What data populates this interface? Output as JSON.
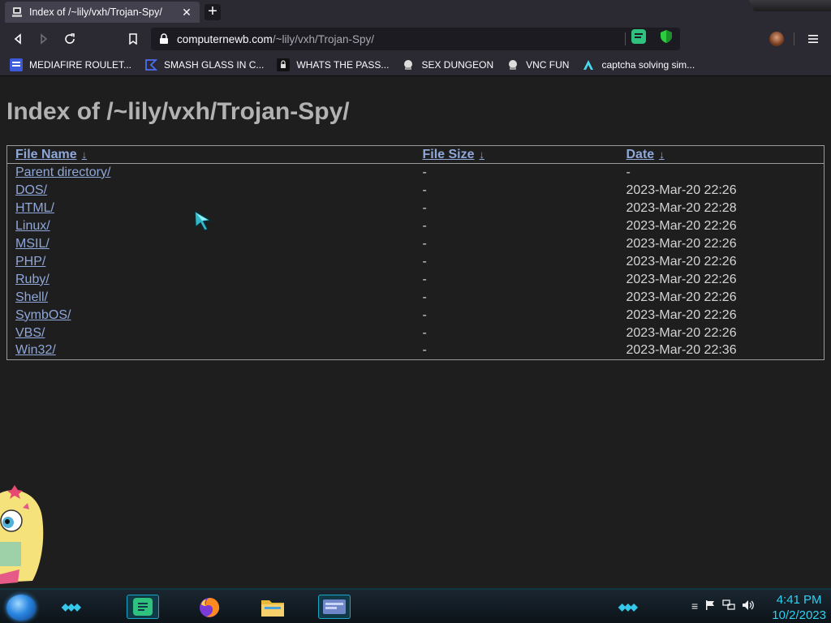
{
  "browser": {
    "tab": {
      "title": "Index of /~lily/vxh/Trojan-Spy/",
      "close_label": "✕"
    },
    "new_tab_label": "+",
    "url": {
      "host": "computernewb.com",
      "path": "/~lily/vxh/Trojan-Spy/"
    },
    "bookmarks": [
      {
        "label": "MEDIAFIRE ROULET...",
        "icon": "mediafire-icon"
      },
      {
        "label": "SMASH GLASS IN C...",
        "icon": "smash-glass-icon"
      },
      {
        "label": "WHATS THE PASS...",
        "icon": "password-site-icon"
      },
      {
        "label": "SEX DUNGEON",
        "icon": "dungeon-icon"
      },
      {
        "label": "VNC FUN",
        "icon": "vnc-icon"
      },
      {
        "label": "captcha solving sim...",
        "icon": "captcha-icon"
      }
    ]
  },
  "page": {
    "title": "Index of /~lily/vxh/Trojan-Spy/",
    "columns": {
      "name": "File Name",
      "size": "File Size",
      "date": "Date",
      "sort_arrow": "↓"
    },
    "rows": [
      {
        "name": "Parent directory/",
        "size": "-",
        "date": "-"
      },
      {
        "name": "DOS/",
        "size": "-",
        "date": "2023-Mar-20 22:26"
      },
      {
        "name": "HTML/",
        "size": "-",
        "date": "2023-Mar-20 22:28"
      },
      {
        "name": "Linux/",
        "size": "-",
        "date": "2023-Mar-20 22:26"
      },
      {
        "name": "MSIL/",
        "size": "-",
        "date": "2023-Mar-20 22:26"
      },
      {
        "name": "PHP/",
        "size": "-",
        "date": "2023-Mar-20 22:26"
      },
      {
        "name": "Ruby/",
        "size": "-",
        "date": "2023-Mar-20 22:26"
      },
      {
        "name": "Shell/",
        "size": "-",
        "date": "2023-Mar-20 22:26"
      },
      {
        "name": "SymbOS/",
        "size": "-",
        "date": "2023-Mar-20 22:26"
      },
      {
        "name": "VBS/",
        "size": "-",
        "date": "2023-Mar-20 22:26"
      },
      {
        "name": "Win32/",
        "size": "-",
        "date": "2023-Mar-20 22:36"
      }
    ]
  },
  "taskbar": {
    "apps": [
      "notes-app-icon",
      "firefox-icon",
      "file-explorer-icon",
      "window-manager-icon"
    ],
    "clock": {
      "time": "4:41 PM",
      "date": "10/2/2023"
    }
  },
  "colors": {
    "link": "#8fa7d9",
    "heading": "#b2b2b2",
    "page_bg": "#1e1e1f",
    "accent": "#2fd0f0"
  }
}
